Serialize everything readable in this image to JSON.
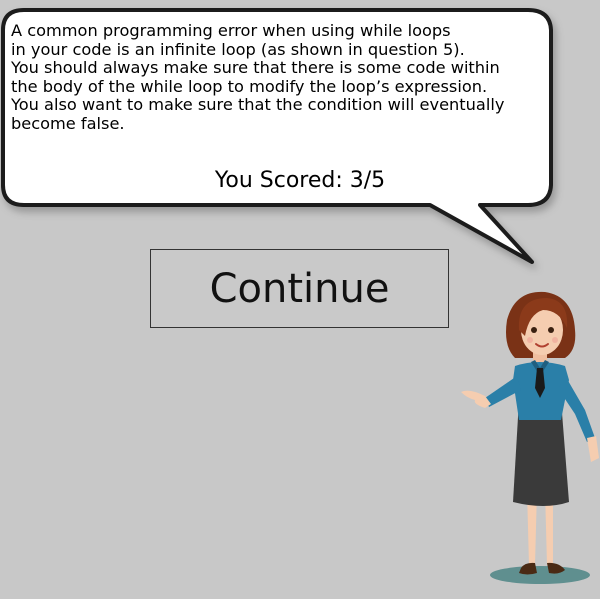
{
  "dialog": {
    "lines": [
      "A common programming error when using while loops",
      "in your code is an infinite loop (as shown in question 5).",
      "You should always make sure that there is some code within",
      "the body of the while loop to modify the loop’s expression.",
      "You also want to make sure that the condition will eventually",
      "become false."
    ],
    "score_text": "You Scored: 3/5"
  },
  "continue_button": {
    "label": "Continue"
  },
  "colors": {
    "background": "#c8c8c8",
    "bubble_fill": "#ffffff",
    "bubble_border": "#1a1a1a",
    "shirt": "#2a7fa8",
    "skirt": "#3a3a3a",
    "hair": "#8b3a1a",
    "skin": "#f5cdb0",
    "shadow": "#5f8f8f"
  },
  "icons": {
    "character": "teacher-character-icon"
  }
}
